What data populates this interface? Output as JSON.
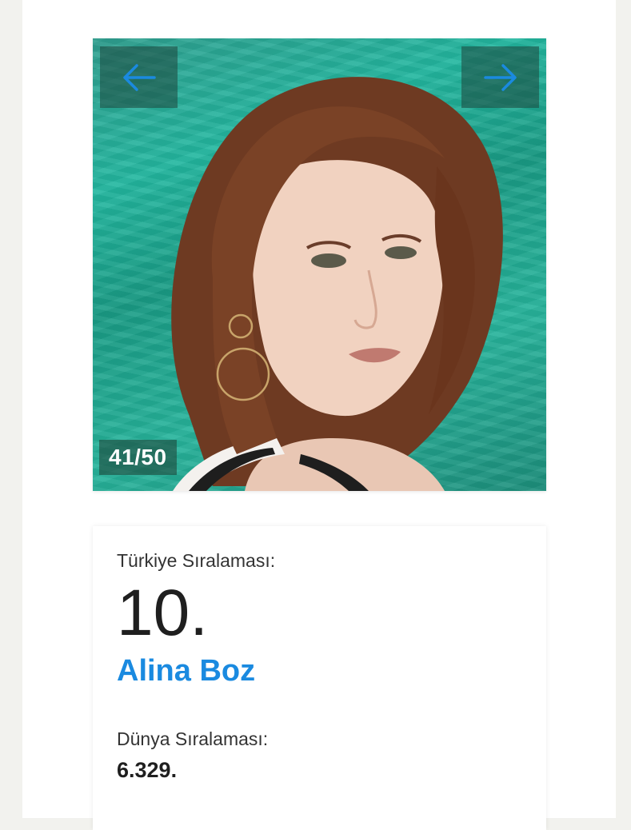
{
  "gallery": {
    "prev_icon": "arrow-left-icon",
    "next_icon": "arrow-right-icon",
    "counter": "41/50",
    "arrow_color": "#1a8ae0"
  },
  "profile": {
    "turkey_rank_label": "Türkiye Sıralaması:",
    "turkey_rank": "10.",
    "name": "Alina Boz",
    "world_rank_label": "Dünya Sıralaması:",
    "world_rank": "6.329."
  },
  "colors": {
    "accent": "#1a8ae0",
    "background": "#f2f2ee",
    "card": "#ffffff"
  }
}
